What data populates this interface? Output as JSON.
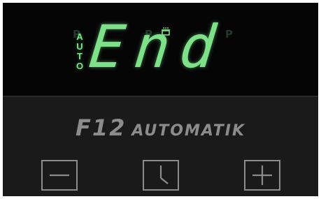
{
  "display": {
    "main_text": "End",
    "auto_indicator": [
      "A",
      "U",
      "T",
      "O"
    ],
    "ghost_program_labels": [
      "P",
      "P",
      "P"
    ],
    "cook_indicator_icon": "pot-icon",
    "segment_color": "#7fe08a"
  },
  "brand": {
    "model": "F12",
    "mode": "AUTOMATIK"
  },
  "controls": {
    "minus_icon": "minus-icon",
    "clock_icon": "clock-icon",
    "plus_icon": "plus-icon"
  },
  "colors": {
    "panel": "#1a1a1a",
    "display_bg": "#050505",
    "label_gray": "#8c8c8c"
  }
}
